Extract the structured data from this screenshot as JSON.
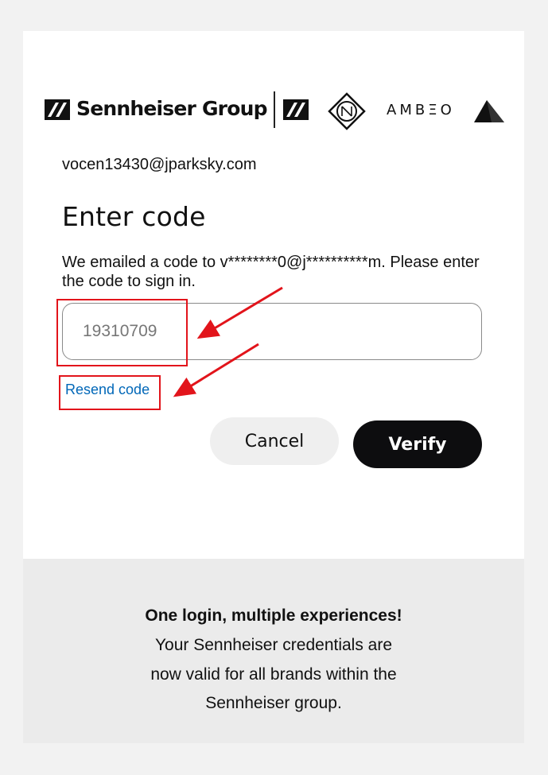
{
  "brands": {
    "sennheiser_group": "Sennheiser Group",
    "ambeo": "AMBΞO"
  },
  "account": {
    "email": "vocen13430@jparksky.com"
  },
  "form": {
    "heading": "Enter code",
    "description": "We emailed a code to v********0@j**********m. Please enter the code to sign in.",
    "code_value": "19310709",
    "resend_label": "Resend code",
    "cancel_label": "Cancel",
    "verify_label": "Verify"
  },
  "footer": {
    "title": "One login, multiple experiences!",
    "lines": [
      "Your Sennheiser credentials are",
      "now valid for all brands within the",
      "Sennheiser group."
    ]
  },
  "colors": {
    "annotation": "#e2141b",
    "link": "#0067b8",
    "primary_button": "#0d0d0f"
  },
  "icons": [
    "sennheiser-logo-icon",
    "neumann-logo-icon",
    "dear-reality-logo-icon",
    "annotation-arrow-icon"
  ]
}
